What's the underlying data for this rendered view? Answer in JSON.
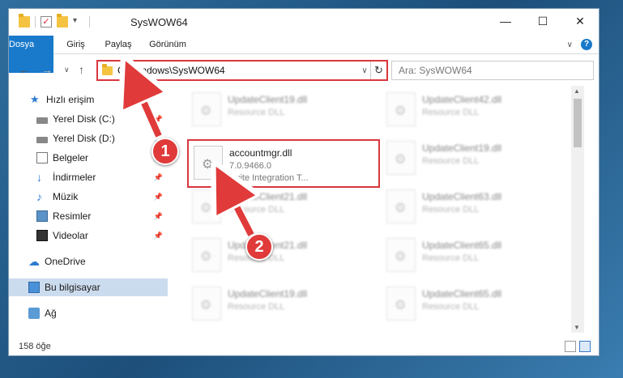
{
  "window": {
    "title": "SysWOW64"
  },
  "window_controls": {
    "minimize": "—",
    "maximize": "☐",
    "close": "✕"
  },
  "ribbon": {
    "tabs": [
      "Dosya",
      "Giriş",
      "Paylaş",
      "Görünüm"
    ],
    "expand_chevron": "∨",
    "help": "?"
  },
  "address": {
    "path": "C:\\Windows\\SysWOW64",
    "search_placeholder": "Ara: SysWOW64"
  },
  "nav": {
    "back": "←",
    "forward": "→",
    "recent": "∨",
    "up": "↑"
  },
  "sidebar": {
    "items": [
      {
        "label": "Hızlı erişim",
        "icon": "star-icon"
      },
      {
        "label": "Yerel Disk (C:)",
        "icon": "drive-icon",
        "pinned": true
      },
      {
        "label": "Yerel Disk (D:)",
        "icon": "drive-icon",
        "pinned": true
      },
      {
        "label": "Belgeler",
        "icon": "documents-icon",
        "pinned": true
      },
      {
        "label": "İndirmeler",
        "icon": "downloads-icon",
        "pinned": true
      },
      {
        "label": "Müzik",
        "icon": "music-icon",
        "pinned": true
      },
      {
        "label": "Resimler",
        "icon": "pictures-icon",
        "pinned": true
      },
      {
        "label": "Videolar",
        "icon": "videos-icon",
        "pinned": true
      },
      {
        "label": "OneDrive",
        "icon": "cloud-icon"
      },
      {
        "label": "Bu bilgisayar",
        "icon": "computer-icon",
        "selected": true
      },
      {
        "label": "Ağ",
        "icon": "network-icon"
      }
    ]
  },
  "files": {
    "highlighted": {
      "name": "accountmgr.dll",
      "version": "7.0.9466.0",
      "description": "Suite Integration T..."
    },
    "left_column": [
      {
        "name": "UpdateClient19.dll",
        "description": "Resource DLL"
      },
      {
        "name": "",
        "description": ""
      },
      {
        "name": "UpdateClient21.dll",
        "description": "Resource DLL"
      },
      {
        "name": "UpdateClient21.dll",
        "description": "Resource DLL"
      },
      {
        "name": "UpdateClient19.dll",
        "description": "Resource DLL"
      },
      {
        "name": "UpdateClient19.dll",
        "description": "Resource DLL"
      }
    ],
    "right_column": [
      {
        "name": "UpdateClient42.dll",
        "description": "Resource DLL"
      },
      {
        "name": "UpdateClient19.dll",
        "description": "Resource DLL"
      },
      {
        "name": "UpdateClient63.dll",
        "description": "Resource DLL"
      },
      {
        "name": "UpdateClient65.dll",
        "description": "Resource DLL"
      },
      {
        "name": "UpdateClient65.dll",
        "description": "Resource DLL"
      },
      {
        "name": "UpdateClient15.dll",
        "description": "Resource DLL"
      }
    ]
  },
  "status": {
    "item_count": "158 öğe"
  },
  "annotations": {
    "step1": "1",
    "step2": "2",
    "color": "#d9363e"
  }
}
